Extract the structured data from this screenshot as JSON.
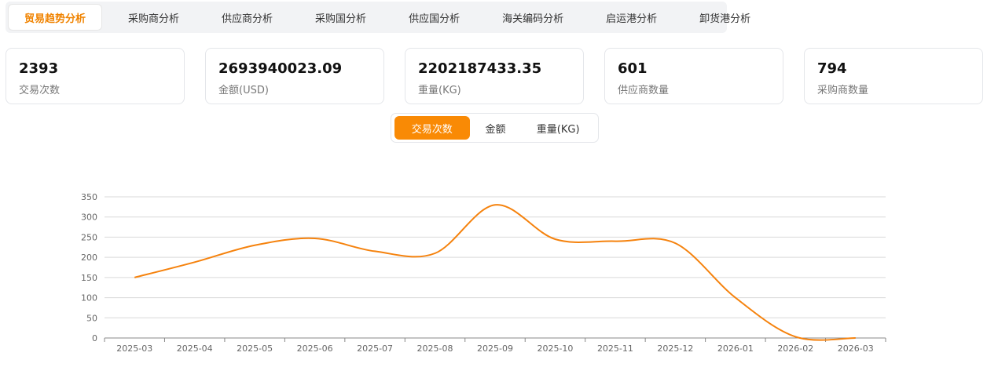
{
  "tabs": [
    "贸易趋势分析",
    "采购商分析",
    "供应商分析",
    "采购国分析",
    "供应国分析",
    "海关编码分析",
    "启运港分析",
    "卸货港分析"
  ],
  "active_tab": 0,
  "stats": [
    {
      "value": "2393",
      "label": "交易次数"
    },
    {
      "value": "2693940023.09",
      "label": "金额(USD)"
    },
    {
      "value": "2202187433.35",
      "label": "重量(KG)"
    },
    {
      "value": "601",
      "label": "供应商数量"
    },
    {
      "value": "794",
      "label": "采购商数量"
    }
  ],
  "metric_toggle": [
    "交易次数",
    "金额",
    "重量(KG)"
  ],
  "active_metric": 0,
  "colors": {
    "accent": "#f98a05",
    "line": "#f5820d",
    "grid": "#d9d9d9"
  },
  "chart_data": {
    "type": "line",
    "categories": [
      "2025-03",
      "2025-04",
      "2025-05",
      "2025-06",
      "2025-07",
      "2025-08",
      "2025-09",
      "2025-10",
      "2025-11",
      "2025-12",
      "2026-01",
      "2026-02",
      "2026-03"
    ],
    "series": [
      {
        "values": [
          150,
          188,
          230,
          247,
          215,
          210,
          330,
          245,
          240,
          235,
          100,
          3,
          0
        ]
      }
    ],
    "y_ticks": [
      0,
      50,
      100,
      150,
      200,
      250,
      300,
      350
    ],
    "ylim": [
      0,
      350
    ],
    "grid": true,
    "title": "",
    "xlabel": "",
    "ylabel": ""
  }
}
